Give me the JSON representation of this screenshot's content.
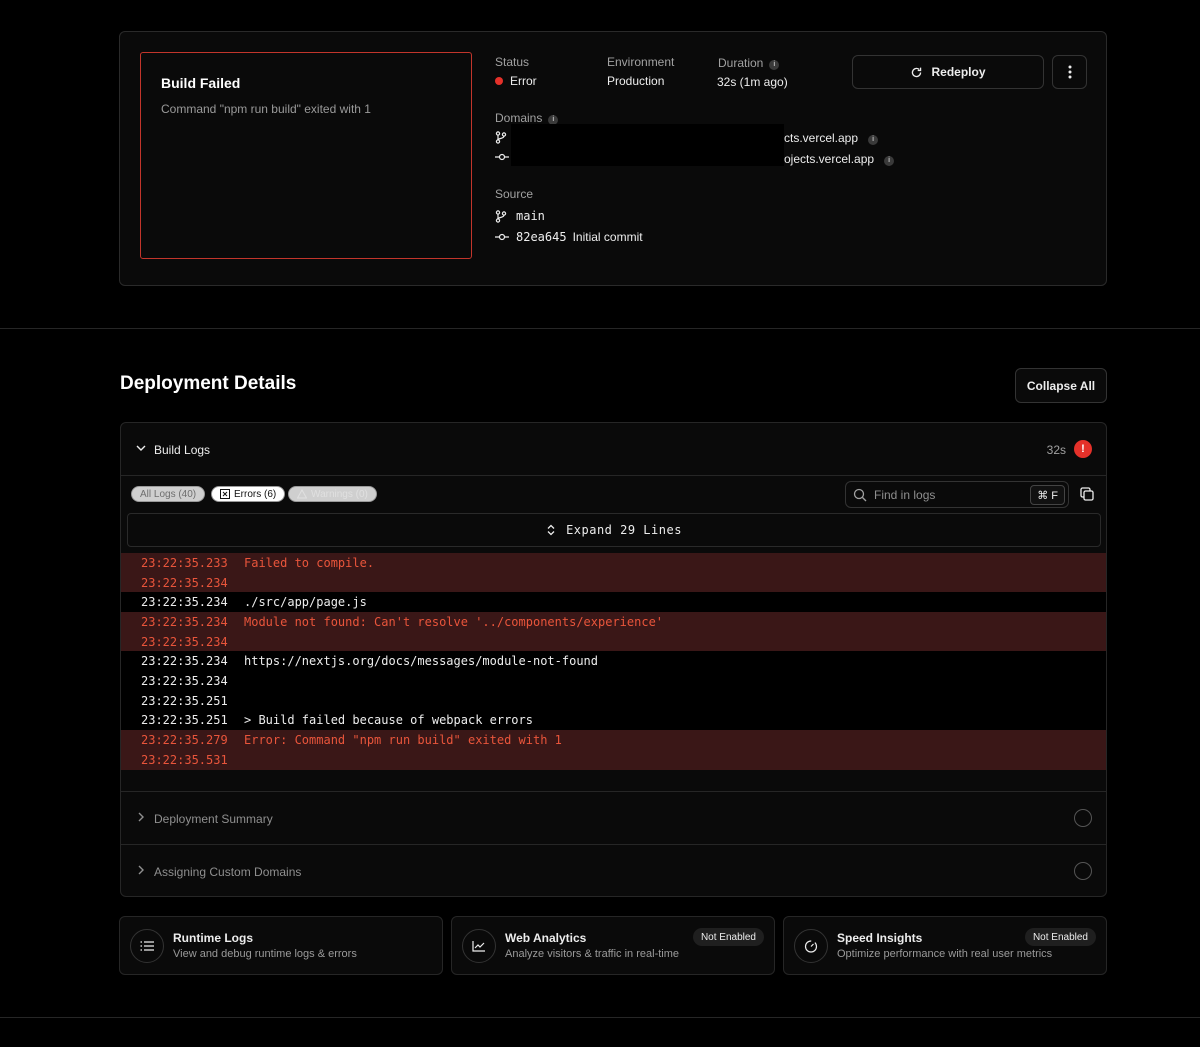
{
  "preview": {
    "title": "Build Failed",
    "subtitle": "Command \"npm run build\" exited with 1"
  },
  "meta": {
    "status_label": "Status",
    "status_value": "Error",
    "environment_label": "Environment",
    "environment_value": "Production",
    "duration_label": "Duration",
    "duration_value": "32s (1m ago)",
    "domains_label": "Domains",
    "domains": [
      "cts.vercel.app",
      "ojects.vercel.app"
    ],
    "source_label": "Source",
    "branch": "main",
    "commit_hash": "82ea645",
    "commit_message": "Initial commit"
  },
  "actions": {
    "redeploy_label": "Redeploy",
    "collapse_label": "Collapse All"
  },
  "section_title": "Deployment Details",
  "build_logs": {
    "title": "Build Logs",
    "duration": "32s",
    "error_badge": "!",
    "filters": {
      "all": "All Logs (40)",
      "errors": "Errors (6)",
      "warnings": "Warnings (0)"
    },
    "search_placeholder": "Find in logs",
    "search_shortcut": "⌘ F",
    "expand_label": "Expand 29 Lines",
    "rows": [
      {
        "ts": "23:22:35.233",
        "msg": "Failed to compile.",
        "error": true
      },
      {
        "ts": "23:22:35.234",
        "msg": "",
        "error": true
      },
      {
        "ts": "23:22:35.234",
        "msg": "./src/app/page.js",
        "error": false
      },
      {
        "ts": "23:22:35.234",
        "msg": "Module not found: Can't resolve '../components/experience'",
        "error": true
      },
      {
        "ts": "23:22:35.234",
        "msg": "",
        "error": true
      },
      {
        "ts": "23:22:35.234",
        "msg": "https://nextjs.org/docs/messages/module-not-found",
        "error": false
      },
      {
        "ts": "23:22:35.234",
        "msg": "",
        "error": false
      },
      {
        "ts": "23:22:35.251",
        "msg": "",
        "error": false
      },
      {
        "ts": "23:22:35.251",
        "msg": "> Build failed because of webpack errors",
        "error": false
      },
      {
        "ts": "23:22:35.279",
        "msg": "Error: Command \"npm run build\" exited with 1",
        "error": true
      },
      {
        "ts": "23:22:35.531",
        "msg": "",
        "error": true
      }
    ]
  },
  "accordion": {
    "summary": "Deployment Summary",
    "domains": "Assigning Custom Domains"
  },
  "features": [
    {
      "title": "Runtime Logs",
      "desc": "View and debug runtime logs & errors",
      "badge": ""
    },
    {
      "title": "Web Analytics",
      "desc": "Analyze visitors & traffic in real-time",
      "badge": "Not Enabled"
    },
    {
      "title": "Speed Insights",
      "desc": "Optimize performance with real user metrics",
      "badge": "Not Enabled"
    }
  ],
  "colors": {
    "error": "#e5312a",
    "error_row_bg": "#3a1717",
    "error_text": "#e9553b"
  }
}
